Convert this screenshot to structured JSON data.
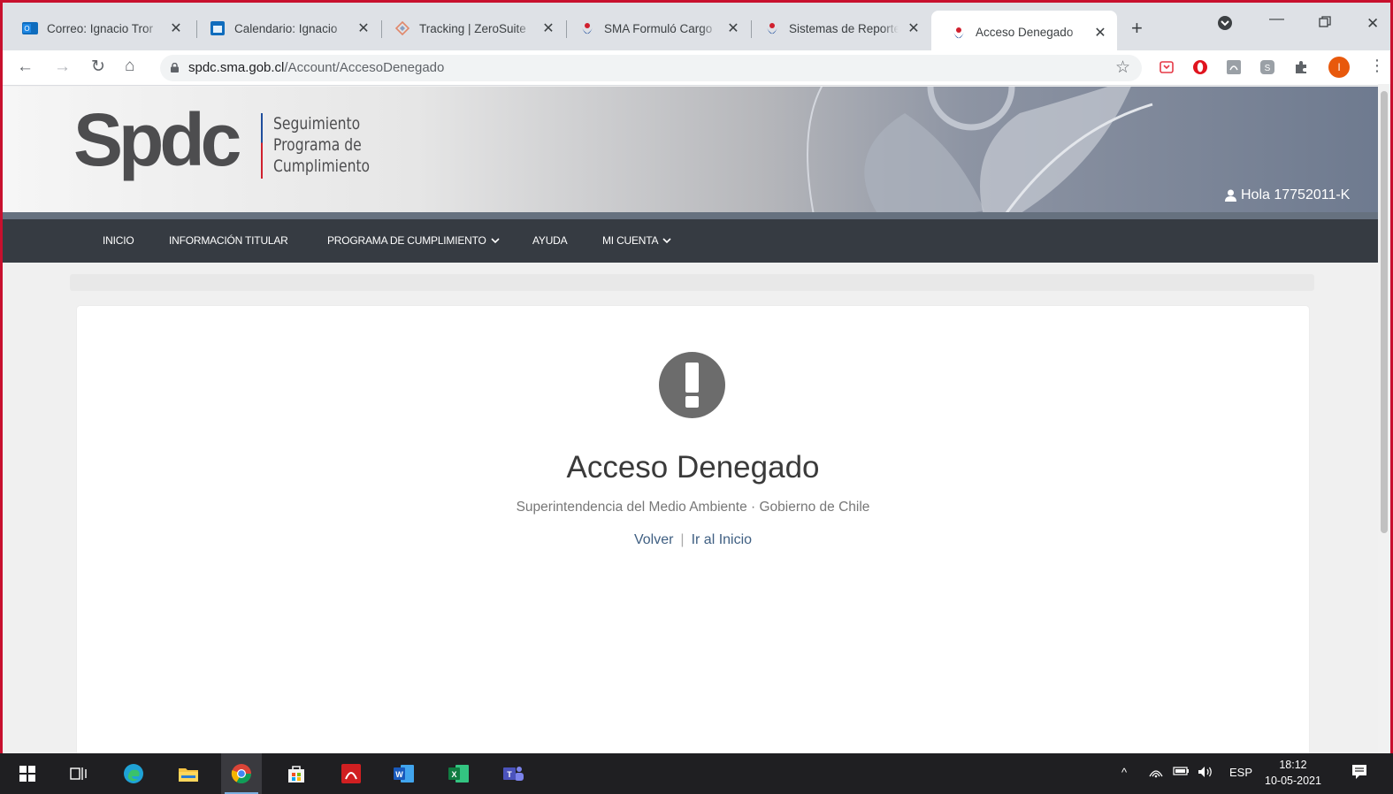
{
  "browser": {
    "tabs": [
      {
        "label": "Correo: Ignacio Tror",
        "icon": "outlook-icon"
      },
      {
        "label": "Calendario: Ignacio",
        "icon": "calendar-icon"
      },
      {
        "label": "Tracking | ZeroSuite",
        "icon": "zerosuite-icon"
      },
      {
        "label": "SMA Formuló Cargo",
        "icon": "sma-icon"
      },
      {
        "label": "Sistemas de Reporte",
        "icon": "sma-icon"
      },
      {
        "label": "Acceso Denegado",
        "icon": "sma-icon"
      }
    ],
    "active_tab": 5,
    "url_host": "spdc.sma.gob.cl",
    "url_path": "/Account/AccesoDenegado",
    "profile_initial": "I"
  },
  "site": {
    "logo_word": "Spdc",
    "logo_lines": [
      "Seguimiento",
      "Programa de",
      "Cumplimiento"
    ],
    "greeting": "Hola 17752011-K",
    "nav": [
      {
        "label": "INICIO",
        "dropdown": false
      },
      {
        "label": "INFORMACIÓN TITULAR",
        "dropdown": false
      },
      {
        "label": "PROGRAMA DE CUMPLIMIENTO",
        "dropdown": true
      },
      {
        "label": "AYUDA",
        "dropdown": false
      },
      {
        "label": "MI CUENTA",
        "dropdown": true
      }
    ]
  },
  "content": {
    "title": "Acceso Denegado",
    "subtitle": "Superintendencia del Medio Ambiente · Gobierno de Chile",
    "link_back": "Volver",
    "link_separator": "|",
    "link_home": "Ir al Inicio"
  },
  "taskbar": {
    "language": "ESP",
    "time": "18:12",
    "date": "10-05-2021"
  },
  "colors": {
    "frame": "#c8102e",
    "nav_bg": "#363b42",
    "link": "#3f5f82",
    "alert_icon": "#6c6c6c"
  }
}
